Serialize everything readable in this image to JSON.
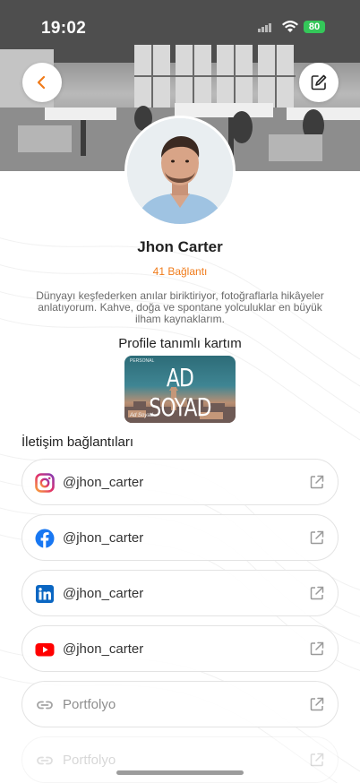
{
  "status_bar": {
    "time": "19:02",
    "battery": "80",
    "wifi_icon": "wifi-icon",
    "signal_icon": "signal-icon"
  },
  "header": {
    "back_icon": "chevron-left-icon",
    "edit_icon": "edit-icon",
    "accent": "#f07b1a"
  },
  "profile": {
    "name": "Jhon Carter",
    "connections": "41 Bağlantı",
    "bio": "Dünyayı keşfederken anılar biriktiriyor, fotoğraflarla hikâyeler anlatıyorum. Kahve, doğa ve spontane yolculuklar en büyük ilham kaynaklarım."
  },
  "card": {
    "title": "Profile tanımlı kartım",
    "big_text": "AD SOYAD",
    "small_text": "PERSONAL",
    "signature": "Ad Soyad"
  },
  "contacts": {
    "title": "İletişim bağlantıları",
    "items": [
      {
        "icon": "instagram-icon",
        "label": "@jhon_carter",
        "action_icon": "external-link-icon"
      },
      {
        "icon": "facebook-icon",
        "label": "@jhon_carter",
        "action_icon": "external-link-icon"
      },
      {
        "icon": "linkedin-icon",
        "label": "@jhon_carter",
        "action_icon": "external-link-icon"
      },
      {
        "icon": "youtube-icon",
        "label": "@jhon_carter",
        "action_icon": "external-link-icon"
      },
      {
        "icon": "link-icon",
        "label": "Portfolyo",
        "action_icon": "external-link-icon"
      },
      {
        "icon": "link-icon",
        "label": "Portfolyo",
        "action_icon": "external-link-icon"
      }
    ]
  }
}
